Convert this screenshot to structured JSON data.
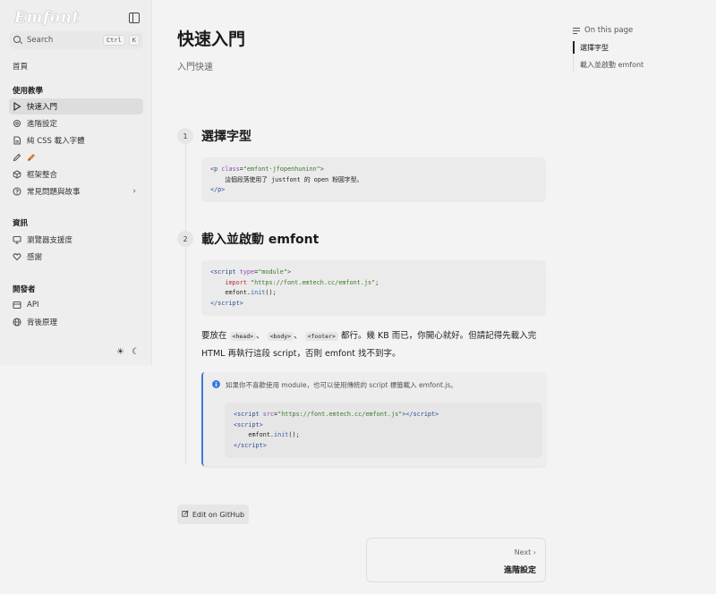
{
  "brand": {
    "logo": "Emfont"
  },
  "search": {
    "label": "Search",
    "kbd1": "Ctrl",
    "kbd2": "K"
  },
  "sidebar": {
    "home": "首頁",
    "section_tutorial": "使用教學",
    "items_tutorial": [
      {
        "label": "快速入門",
        "icon": "play-icon"
      },
      {
        "label": "進階設定",
        "icon": "gear-icon"
      },
      {
        "label": "純 CSS 載入字體",
        "icon": "file-icon"
      },
      {
        "label": "",
        "icon": "pencil-icon"
      },
      {
        "label": "框架整合",
        "icon": "cube-icon"
      },
      {
        "label": "常見問題與故事",
        "icon": "question-icon"
      }
    ],
    "section_info": "資訊",
    "items_info": [
      {
        "label": "瀏覽器支援度",
        "icon": "monitor-icon"
      },
      {
        "label": "感謝",
        "icon": "heart-icon"
      }
    ],
    "section_dev": "開發者",
    "items_dev": [
      {
        "label": "API",
        "icon": "api-icon"
      },
      {
        "label": "背後原理",
        "icon": "globe-icon"
      }
    ]
  },
  "main": {
    "title": "快速入門",
    "subtitle": "入門快速",
    "step1": {
      "num": "1",
      "title": "選擇字型"
    },
    "step2": {
      "num": "2",
      "title": "載入並啟動 emfont"
    },
    "para_1": "要放在",
    "para_code1": "<head>",
    "para_sep1": "、",
    "para_code2": "<body>",
    "para_sep2": "、",
    "para_code3": "<footer>",
    "para_2": "都行。幾 KB 而已，你開心就好。但請記得先載入完 HTML 再執行這段 script，否則 emfont 找不到字。",
    "callout_text": "如果你不喜歡使用 module，也可以使用傳統的 script 標籤載入 emfont.js。",
    "edit_label": "Edit on GitHub",
    "next_label": "Next ›",
    "next_title": "進階設定"
  },
  "toc": {
    "header": "On this page",
    "items": [
      "選擇字型",
      "載入並啟動 emfont"
    ]
  },
  "colors": {
    "accent": "#3d7bd9",
    "background": "#f3f3f3",
    "sidebar": "#eeeeee"
  }
}
